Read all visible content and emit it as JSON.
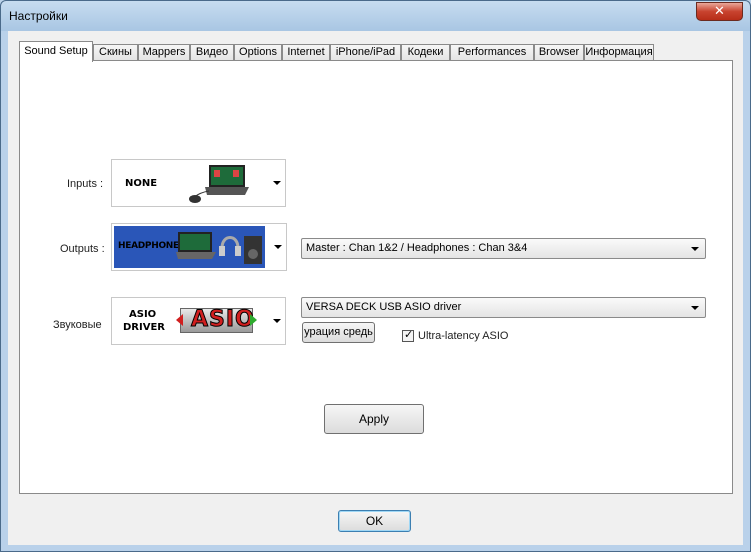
{
  "window": {
    "title": "Настройки"
  },
  "tabs": [
    {
      "label": "Sound Setup"
    },
    {
      "label": "Скины"
    },
    {
      "label": "Mappers"
    },
    {
      "label": "Видео"
    },
    {
      "label": "Options"
    },
    {
      "label": "Internet"
    },
    {
      "label": "iPhone/iPad"
    },
    {
      "label": "Кодеки"
    },
    {
      "label": "Performances"
    },
    {
      "label": "Browser"
    },
    {
      "label": "Информация"
    }
  ],
  "inputs": {
    "label": "Inputs :",
    "image_text": "NONE"
  },
  "outputs": {
    "label": "Outputs :",
    "image_text": "HEADPHONES",
    "combo_value": "Master : Chan 1&2 / Headphones : Chan 3&4"
  },
  "sound": {
    "label": "Звуковые",
    "image_text_1": "ASIO",
    "image_text_2": "DRIVER",
    "logo_text": "ASIO",
    "combo_value": "VERSA DECK USB ASIO driver",
    "config_button": "урация средь",
    "ultra_latency_label": "Ultra-latency ASIO"
  },
  "buttons": {
    "apply": "Apply",
    "ok": "OK"
  },
  "colors": {
    "headphones_bg": "#2a56b8",
    "asio_logo_red": "#d11f1f",
    "close_button": "#c8432f"
  }
}
